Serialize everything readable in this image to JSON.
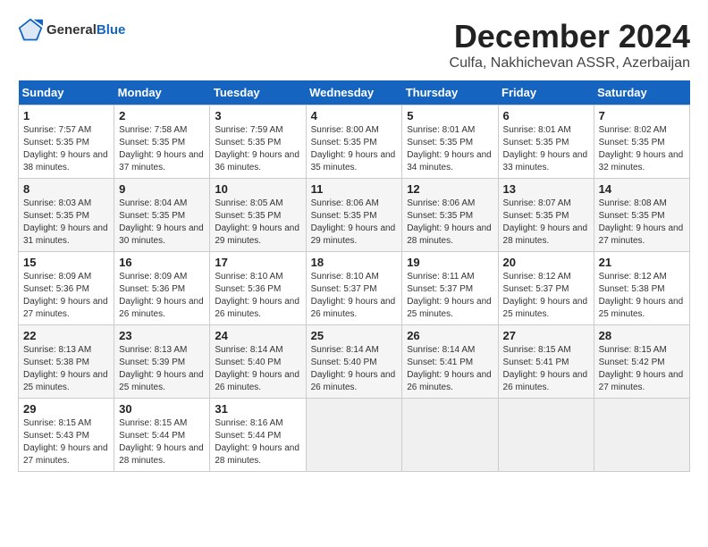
{
  "logo": {
    "general": "General",
    "blue": "Blue"
  },
  "header": {
    "month_year": "December 2024",
    "location": "Culfa, Nakhichevan ASSR, Azerbaijan"
  },
  "weekdays": [
    "Sunday",
    "Monday",
    "Tuesday",
    "Wednesday",
    "Thursday",
    "Friday",
    "Saturday"
  ],
  "weeks": [
    [
      {
        "day": "1",
        "sunrise": "7:57 AM",
        "sunset": "5:35 PM",
        "daylight": "9 hours and 38 minutes."
      },
      {
        "day": "2",
        "sunrise": "7:58 AM",
        "sunset": "5:35 PM",
        "daylight": "9 hours and 37 minutes."
      },
      {
        "day": "3",
        "sunrise": "7:59 AM",
        "sunset": "5:35 PM",
        "daylight": "9 hours and 36 minutes."
      },
      {
        "day": "4",
        "sunrise": "8:00 AM",
        "sunset": "5:35 PM",
        "daylight": "9 hours and 35 minutes."
      },
      {
        "day": "5",
        "sunrise": "8:01 AM",
        "sunset": "5:35 PM",
        "daylight": "9 hours and 34 minutes."
      },
      {
        "day": "6",
        "sunrise": "8:01 AM",
        "sunset": "5:35 PM",
        "daylight": "9 hours and 33 minutes."
      },
      {
        "day": "7",
        "sunrise": "8:02 AM",
        "sunset": "5:35 PM",
        "daylight": "9 hours and 32 minutes."
      }
    ],
    [
      {
        "day": "8",
        "sunrise": "8:03 AM",
        "sunset": "5:35 PM",
        "daylight": "9 hours and 31 minutes."
      },
      {
        "day": "9",
        "sunrise": "8:04 AM",
        "sunset": "5:35 PM",
        "daylight": "9 hours and 30 minutes."
      },
      {
        "day": "10",
        "sunrise": "8:05 AM",
        "sunset": "5:35 PM",
        "daylight": "9 hours and 29 minutes."
      },
      {
        "day": "11",
        "sunrise": "8:06 AM",
        "sunset": "5:35 PM",
        "daylight": "9 hours and 29 minutes."
      },
      {
        "day": "12",
        "sunrise": "8:06 AM",
        "sunset": "5:35 PM",
        "daylight": "9 hours and 28 minutes."
      },
      {
        "day": "13",
        "sunrise": "8:07 AM",
        "sunset": "5:35 PM",
        "daylight": "9 hours and 28 minutes."
      },
      {
        "day": "14",
        "sunrise": "8:08 AM",
        "sunset": "5:35 PM",
        "daylight": "9 hours and 27 minutes."
      }
    ],
    [
      {
        "day": "15",
        "sunrise": "8:09 AM",
        "sunset": "5:36 PM",
        "daylight": "9 hours and 27 minutes."
      },
      {
        "day": "16",
        "sunrise": "8:09 AM",
        "sunset": "5:36 PM",
        "daylight": "9 hours and 26 minutes."
      },
      {
        "day": "17",
        "sunrise": "8:10 AM",
        "sunset": "5:36 PM",
        "daylight": "9 hours and 26 minutes."
      },
      {
        "day": "18",
        "sunrise": "8:10 AM",
        "sunset": "5:37 PM",
        "daylight": "9 hours and 26 minutes."
      },
      {
        "day": "19",
        "sunrise": "8:11 AM",
        "sunset": "5:37 PM",
        "daylight": "9 hours and 25 minutes."
      },
      {
        "day": "20",
        "sunrise": "8:12 AM",
        "sunset": "5:37 PM",
        "daylight": "9 hours and 25 minutes."
      },
      {
        "day": "21",
        "sunrise": "8:12 AM",
        "sunset": "5:38 PM",
        "daylight": "9 hours and 25 minutes."
      }
    ],
    [
      {
        "day": "22",
        "sunrise": "8:13 AM",
        "sunset": "5:38 PM",
        "daylight": "9 hours and 25 minutes."
      },
      {
        "day": "23",
        "sunrise": "8:13 AM",
        "sunset": "5:39 PM",
        "daylight": "9 hours and 25 minutes."
      },
      {
        "day": "24",
        "sunrise": "8:14 AM",
        "sunset": "5:40 PM",
        "daylight": "9 hours and 26 minutes."
      },
      {
        "day": "25",
        "sunrise": "8:14 AM",
        "sunset": "5:40 PM",
        "daylight": "9 hours and 26 minutes."
      },
      {
        "day": "26",
        "sunrise": "8:14 AM",
        "sunset": "5:41 PM",
        "daylight": "9 hours and 26 minutes."
      },
      {
        "day": "27",
        "sunrise": "8:15 AM",
        "sunset": "5:41 PM",
        "daylight": "9 hours and 26 minutes."
      },
      {
        "day": "28",
        "sunrise": "8:15 AM",
        "sunset": "5:42 PM",
        "daylight": "9 hours and 27 minutes."
      }
    ],
    [
      {
        "day": "29",
        "sunrise": "8:15 AM",
        "sunset": "5:43 PM",
        "daylight": "9 hours and 27 minutes."
      },
      {
        "day": "30",
        "sunrise": "8:15 AM",
        "sunset": "5:44 PM",
        "daylight": "9 hours and 28 minutes."
      },
      {
        "day": "31",
        "sunrise": "8:16 AM",
        "sunset": "5:44 PM",
        "daylight": "9 hours and 28 minutes."
      },
      null,
      null,
      null,
      null
    ]
  ],
  "labels": {
    "sunrise": "Sunrise:",
    "sunset": "Sunset:",
    "daylight": "Daylight:"
  }
}
